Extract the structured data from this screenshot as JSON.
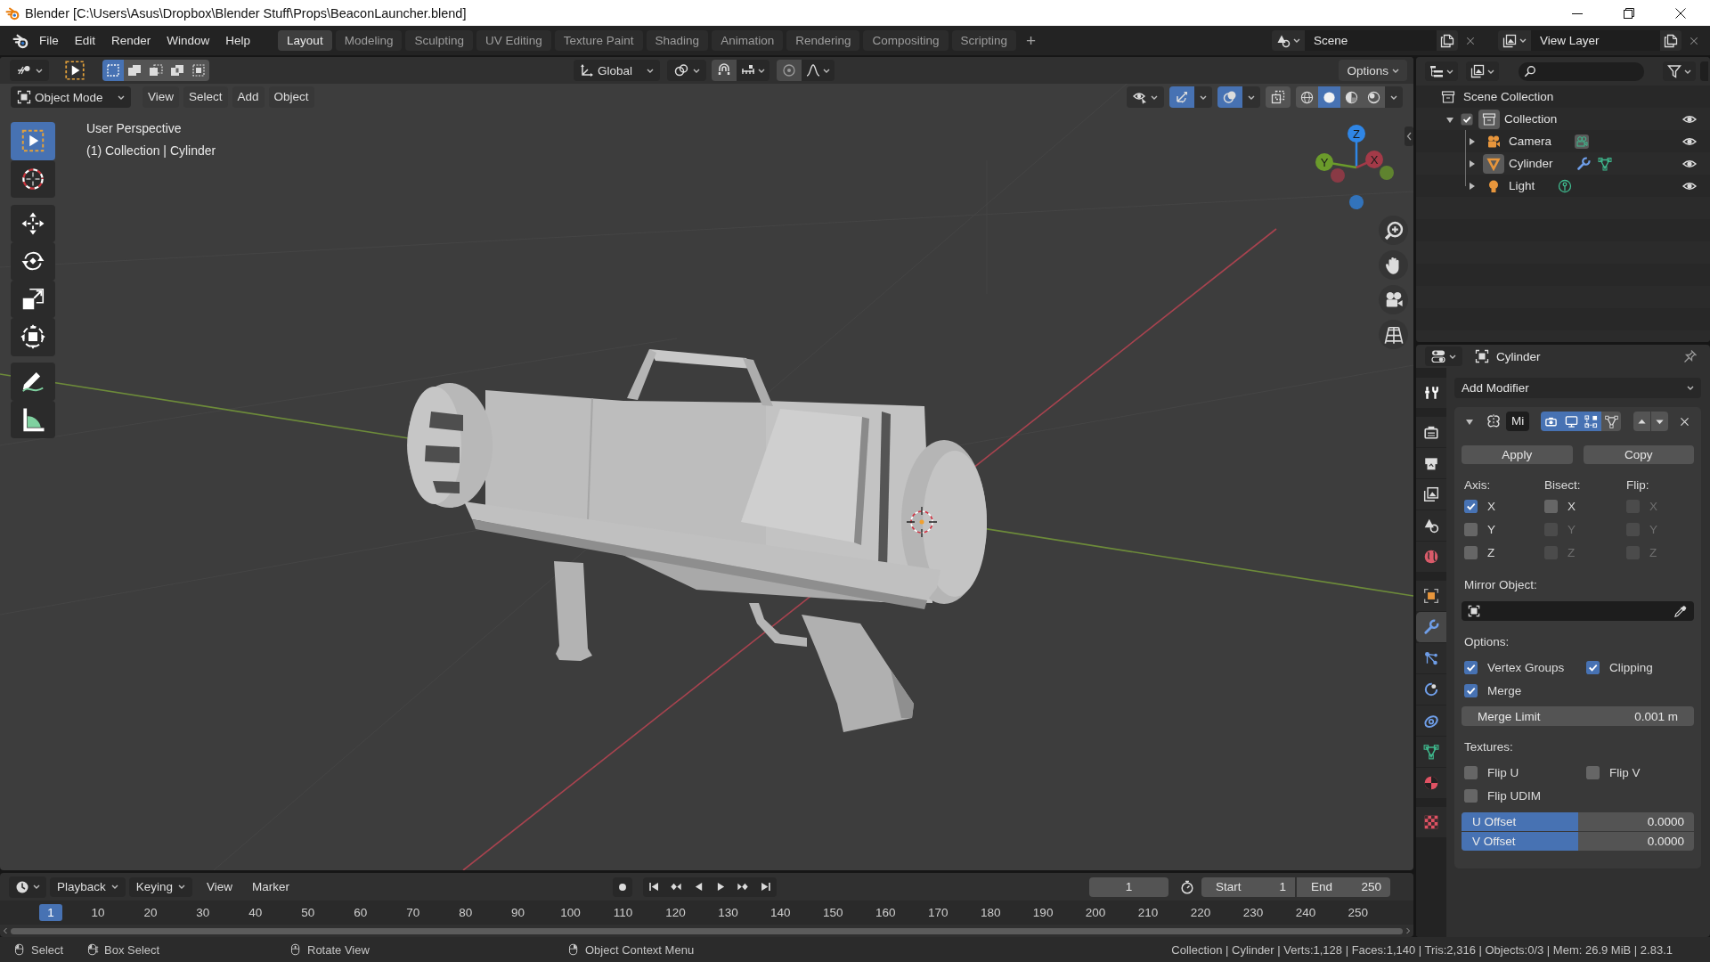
{
  "window": {
    "title": "Blender [C:\\Users\\Asus\\Dropbox\\Blender Stuff\\Props\\BeaconLauncher.blend]"
  },
  "menu": [
    "File",
    "Edit",
    "Render",
    "Window",
    "Help"
  ],
  "workspaces": [
    {
      "label": "Layout",
      "selected": true
    },
    {
      "label": "Modeling",
      "selected": false
    },
    {
      "label": "Sculpting",
      "selected": false
    },
    {
      "label": "UV Editing",
      "selected": false
    },
    {
      "label": "Texture Paint",
      "selected": false
    },
    {
      "label": "Shading",
      "selected": false
    },
    {
      "label": "Animation",
      "selected": false
    },
    {
      "label": "Rendering",
      "selected": false
    },
    {
      "label": "Compositing",
      "selected": false
    },
    {
      "label": "Scripting",
      "selected": false
    }
  ],
  "add_workspace": "+",
  "scene": "Scene",
  "view_layer": "View Layer",
  "viewport": {
    "selection_modes": [
      {
        "kind": "set",
        "selected": true
      },
      {
        "kind": "extend",
        "selected": false
      },
      {
        "kind": "subtract",
        "selected": false
      },
      {
        "kind": "difference",
        "selected": false
      },
      {
        "kind": "intersect",
        "selected": false
      }
    ],
    "orientation": "Global",
    "options": "Options",
    "mode": "Object Mode",
    "menus": [
      "View",
      "Select",
      "Add",
      "Object"
    ],
    "toggles": [
      {
        "kind": "gizmos",
        "on": true
      },
      {
        "kind": "overlays",
        "on": true
      },
      {
        "kind": "xray",
        "on": false
      }
    ],
    "shading": [
      {
        "kind": "wireframe",
        "selected": false
      },
      {
        "kind": "solid",
        "selected": true
      },
      {
        "kind": "material",
        "selected": false
      },
      {
        "kind": "rendered",
        "selected": false
      }
    ],
    "info": [
      "User Perspective",
      "(1) Collection | Cylinder"
    ],
    "tools": [
      {
        "kind": "select_box",
        "selected": true
      },
      {
        "kind": "cursor",
        "selected": false
      },
      {
        "kind": "move",
        "selected": false
      },
      {
        "kind": "rotate",
        "selected": false
      },
      {
        "kind": "scale",
        "selected": false
      },
      {
        "kind": "transform",
        "selected": false
      },
      {
        "kind": "annotate",
        "selected": false
      },
      {
        "kind": "measure",
        "selected": false
      }
    ],
    "gizmo_axes": [
      {
        "label": "Z",
        "color": "#2f86e6"
      },
      {
        "label": "Y",
        "color": "#6b9b2b"
      },
      {
        "label": "X",
        "color": "#a33a48"
      }
    ]
  },
  "outliner": {
    "tree": [
      {
        "label": "Scene Collection",
        "kind": "scene_collection",
        "children": [
          {
            "label": "Collection",
            "kind": "collection",
            "expanded": true,
            "checked": true,
            "active": true,
            "visible": true,
            "children": [
              {
                "label": "Camera",
                "kind": "camera",
                "expanded": false,
                "active": false,
                "visible": true,
                "extras": [
                  {
                    "kind": "camera_data"
                  }
                ]
              },
              {
                "label": "Cylinder",
                "kind": "mesh",
                "expanded": false,
                "active": true,
                "visible": true,
                "extras": [
                  {
                    "kind": "modifier"
                  },
                  {
                    "kind": "mesh_data"
                  }
                ]
              },
              {
                "label": "Light",
                "kind": "light",
                "expanded": false,
                "active": false,
                "visible": true,
                "extras": [
                  {
                    "kind": "light_data"
                  }
                ]
              }
            ]
          }
        ]
      }
    ]
  },
  "properties": {
    "object": "Cylinder",
    "tabs": [
      {
        "kind": "tool",
        "selected": false
      },
      {
        "kind": "render",
        "selected": false
      },
      {
        "kind": "output",
        "selected": false
      },
      {
        "kind": "view_layer",
        "selected": false
      },
      {
        "kind": "scene",
        "selected": false
      },
      {
        "kind": "world",
        "selected": false
      },
      {
        "kind": "object",
        "selected": false
      },
      {
        "kind": "modifiers",
        "selected": true
      },
      {
        "kind": "particles",
        "selected": false
      },
      {
        "kind": "physics",
        "selected": false
      },
      {
        "kind": "constraints",
        "selected": false
      },
      {
        "kind": "data",
        "selected": false
      },
      {
        "kind": "material",
        "selected": false
      },
      {
        "kind": "texture",
        "selected": false
      }
    ],
    "add_modifier": "Add Modifier",
    "modifier": {
      "name": "Mi",
      "expanded": true,
      "toggles": [
        {
          "kind": "render",
          "on": true
        },
        {
          "kind": "viewport",
          "on": true
        },
        {
          "kind": "edit_mode",
          "on": true
        },
        {
          "kind": "cage",
          "on": false
        }
      ],
      "apply": "Apply",
      "copy": "Copy",
      "axis_columns": [
        {
          "label": "Axis:",
          "options": [
            {
              "label": "X",
              "checked": true,
              "disabled": false
            },
            {
              "label": "Y",
              "checked": false,
              "disabled": false
            },
            {
              "label": "Z",
              "checked": false,
              "disabled": false
            }
          ]
        },
        {
          "label": "Bisect:",
          "options": [
            {
              "label": "X",
              "checked": false,
              "disabled": false
            },
            {
              "label": "Y",
              "checked": false,
              "disabled": true
            },
            {
              "label": "Z",
              "checked": false,
              "disabled": true
            }
          ]
        },
        {
          "label": "Flip:",
          "options": [
            {
              "label": "X",
              "checked": false,
              "disabled": true
            },
            {
              "label": "Y",
              "checked": false,
              "disabled": true
            },
            {
              "label": "Z",
              "checked": false,
              "disabled": true
            }
          ]
        }
      ],
      "mirror_object_label": "Mirror Object:",
      "options_label": "Options:",
      "options": [
        {
          "label": "Vertex Groups",
          "checked": true
        },
        {
          "label": "Clipping",
          "checked": true
        },
        {
          "label": "Merge",
          "checked": true
        }
      ],
      "merge_limit": {
        "label": "Merge Limit",
        "value": "0.001 m"
      },
      "textures_label": "Textures:",
      "textures": [
        {
          "label": "Flip U",
          "checked": false
        },
        {
          "label": "Flip V",
          "checked": false
        },
        {
          "label": "Flip UDIM",
          "checked": false
        }
      ],
      "offsets": [
        {
          "label": "U Offset",
          "value": "0.0000",
          "level": 0.5
        },
        {
          "label": "V Offset",
          "value": "0.0000",
          "level": 0.5
        }
      ]
    }
  },
  "timeline": {
    "menus": [
      {
        "label": "Playback",
        "dropdown": true
      },
      {
        "label": "Keying",
        "dropdown": true
      },
      {
        "label": "View",
        "dropdown": false
      },
      {
        "label": "Marker",
        "dropdown": false
      }
    ],
    "current_frame": "1",
    "start": {
      "label": "Start",
      "value": "1"
    },
    "end": {
      "label": "End",
      "value": "250"
    },
    "playhead": "1",
    "ticks": [
      "10",
      "20",
      "30",
      "40",
      "50",
      "60",
      "70",
      "80",
      "90",
      "100",
      "110",
      "120",
      "130",
      "140",
      "150",
      "160",
      "170",
      "180",
      "190",
      "200",
      "210",
      "220",
      "230",
      "240",
      "250"
    ]
  },
  "status_bar": {
    "hints": [
      {
        "kind": "left_click",
        "label": "Select"
      },
      {
        "kind": "drag",
        "label": "Box Select"
      },
      {
        "kind": "middle_click",
        "label": "Rotate View"
      },
      {
        "kind": "right_click",
        "label": "Object Context Menu"
      }
    ],
    "stats": "Collection | Cylinder | Verts:1,128 | Faces:1,140 | Tris:2,316 | Objects:0/3 | Mem: 26.9 MiB | 2.83.1"
  }
}
